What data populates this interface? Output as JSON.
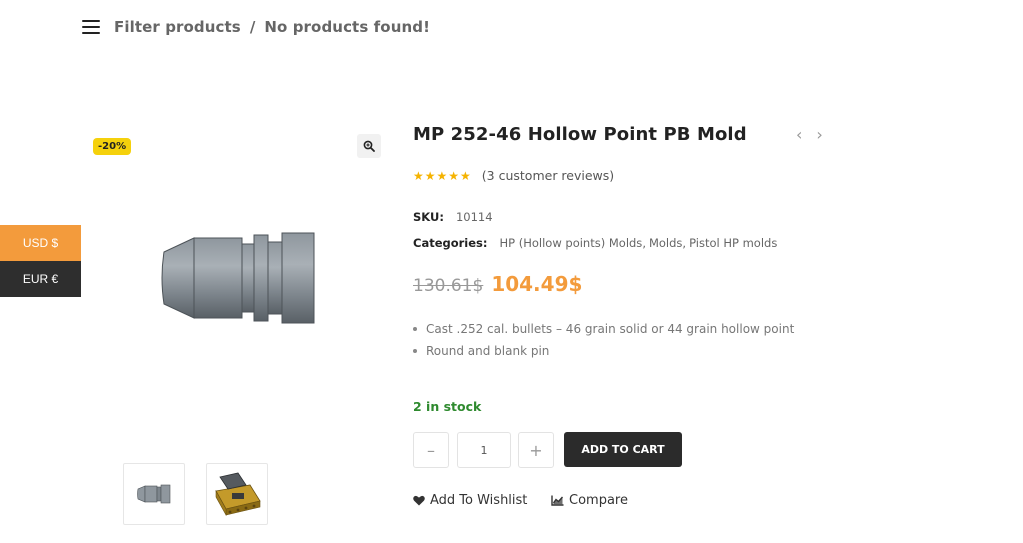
{
  "filter_bar": {
    "filter_label": "Filter products",
    "separator": "/",
    "status": "No products found!"
  },
  "gallery": {
    "badge": "-20%",
    "zoom_icon": "magnifier-icon",
    "main_image": "bullet-image",
    "thumbnails": [
      "bullet-thumbnail",
      "mold-thumbnail"
    ]
  },
  "currency": {
    "items": [
      "USD $",
      "EUR €"
    ],
    "active": "USD $"
  },
  "product": {
    "title": "MP 252-46 Hollow Point PB Mold",
    "stars": "★★★★★",
    "rating_fraction": 1.0,
    "reviews": "(3 customer reviews)",
    "sku_label": "SKU:",
    "sku": "10114",
    "categories_label": "Categories:",
    "categories": [
      "HP (Hollow points) Molds",
      "Molds",
      "Pistol HP molds"
    ],
    "price_old": "130.61$",
    "price_new": "104.49$",
    "features": [
      "Cast .252 cal. bullets –  46 grain solid or 44 grain hollow point",
      "Round and blank pin"
    ],
    "stock": "2 in stock",
    "qty_minus": "–",
    "qty_plus": "+",
    "quantity": "1",
    "add_to_cart": "ADD TO CART",
    "wishlist": "Add To Wishlist",
    "compare": "Compare"
  },
  "colors": {
    "accent": "#f39b3c",
    "badge": "#f5d10c",
    "stock": "#2e8a2e",
    "dark": "#2b2b2b"
  }
}
